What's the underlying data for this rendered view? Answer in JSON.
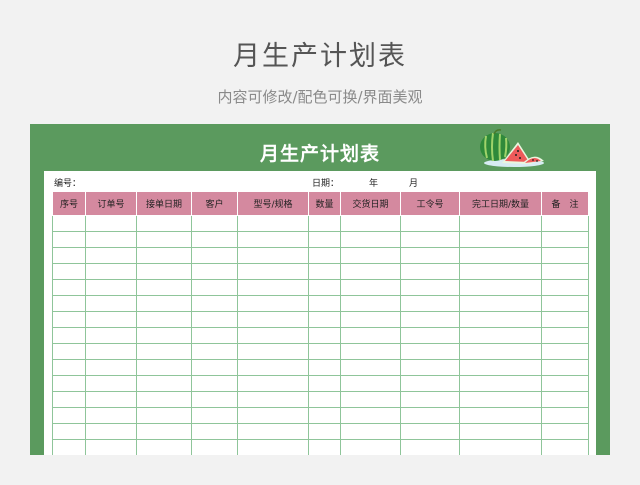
{
  "page": {
    "title": "月生产计划表",
    "subtitle": "内容可修改/配色可换/界面美观"
  },
  "sheet": {
    "title": "月生产计划表",
    "number_label": "编号：",
    "date_label": "日期：",
    "year_label": "年",
    "month_label": "月",
    "decoration_icon": "watermelon-icon",
    "colors": {
      "frame": "#5b9a5e",
      "header": "#d4899f",
      "grid": "#8fc59a"
    }
  },
  "table": {
    "columns": [
      "序号",
      "订单号",
      "接单日期",
      "客户",
      "型号/规格",
      "数量",
      "交货日期",
      "工令号",
      "完工日期/数量",
      "备　注"
    ],
    "empty_rows": 16
  }
}
